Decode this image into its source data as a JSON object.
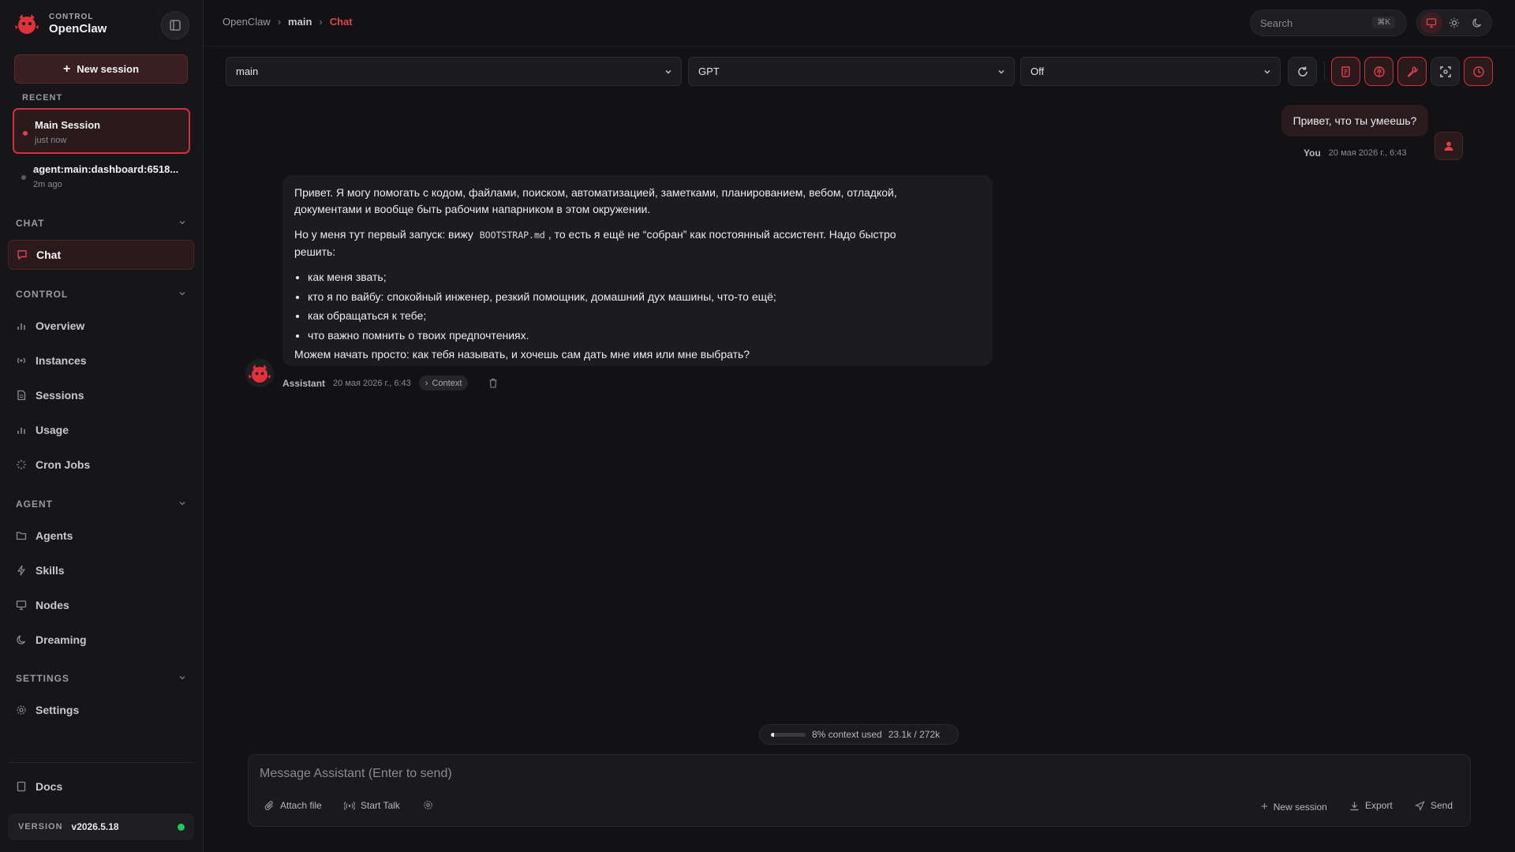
{
  "brand": {
    "small": "CONTROL",
    "name": "OpenClaw"
  },
  "sidebar": {
    "new_session_label": "New session",
    "recent_label": "RECENT",
    "sessions": [
      {
        "title": "Main Session",
        "time": "just now",
        "active": true
      },
      {
        "title": "agent:main:dashboard:6518...",
        "time": "2m ago",
        "active": false
      }
    ],
    "sections": {
      "chat": "CHAT",
      "control": "CONTROL",
      "agent": "AGENT",
      "settings": "SETTINGS"
    },
    "items": {
      "chat": "Chat",
      "overview": "Overview",
      "instances": "Instances",
      "sessions": "Sessions",
      "usage": "Usage",
      "cron_jobs": "Cron Jobs",
      "agents": "Agents",
      "skills": "Skills",
      "nodes": "Nodes",
      "dreaming": "Dreaming",
      "settings": "Settings",
      "docs": "Docs"
    },
    "version_label": "VERSION",
    "version": "v2026.5.18"
  },
  "header": {
    "breadcrumb": [
      "OpenClaw",
      "main",
      "Chat"
    ],
    "search_placeholder": "Search",
    "search_shortcut": "⌘K"
  },
  "toolbar": {
    "agent_select": "main",
    "model_select": "GPT",
    "thinking_select": "Off"
  },
  "chat": {
    "user_message": "Привет, что ты умеешь?",
    "user_name": "You",
    "user_time": "20 мая 2026 г., 6:43",
    "assistant_name": "Assistant",
    "assistant_time": "20 мая 2026 г., 6:43",
    "context_label": "Context",
    "assistant_p1": "Привет. Я могу помогать с кодом, файлами, поиском, автоматизацией, заметками, планированием, вебом, отладкой, документами и вообще быть рабочим напарником в этом окружении.",
    "assistant_p2_before": "Но у меня тут первый запуск: вижу ",
    "assistant_p2_code": "BOOTSTRAP.md",
    "assistant_p2_after": ", то есть я ещё не “собран” как постоянный ассистент. Надо быстро решить:",
    "assistant_list": [
      "как меня звать;",
      "кто я по вайбу: спокойный инженер, резкий помощник, домашний дух машины, что-то ещё;",
      "как обращаться к тебе;",
      "что важно помнить о твоих предпочтениях."
    ],
    "assistant_p3": "Можем начать просто: как тебя называть, и хочешь сам дать мне имя или мне выбрать?"
  },
  "composer": {
    "context_used_text": "8% context used",
    "context_tokens": "23.1k / 272k",
    "context_fraction": 0.08,
    "placeholder": "Message Assistant (Enter to send)",
    "attach_label": "Attach file",
    "talk_label": "Start Talk",
    "new_session_label": "New session",
    "export_label": "Export",
    "send_label": "Send"
  },
  "colors": {
    "accent": "#d0323d",
    "background": "#121214",
    "status_online": "#22c55e"
  }
}
